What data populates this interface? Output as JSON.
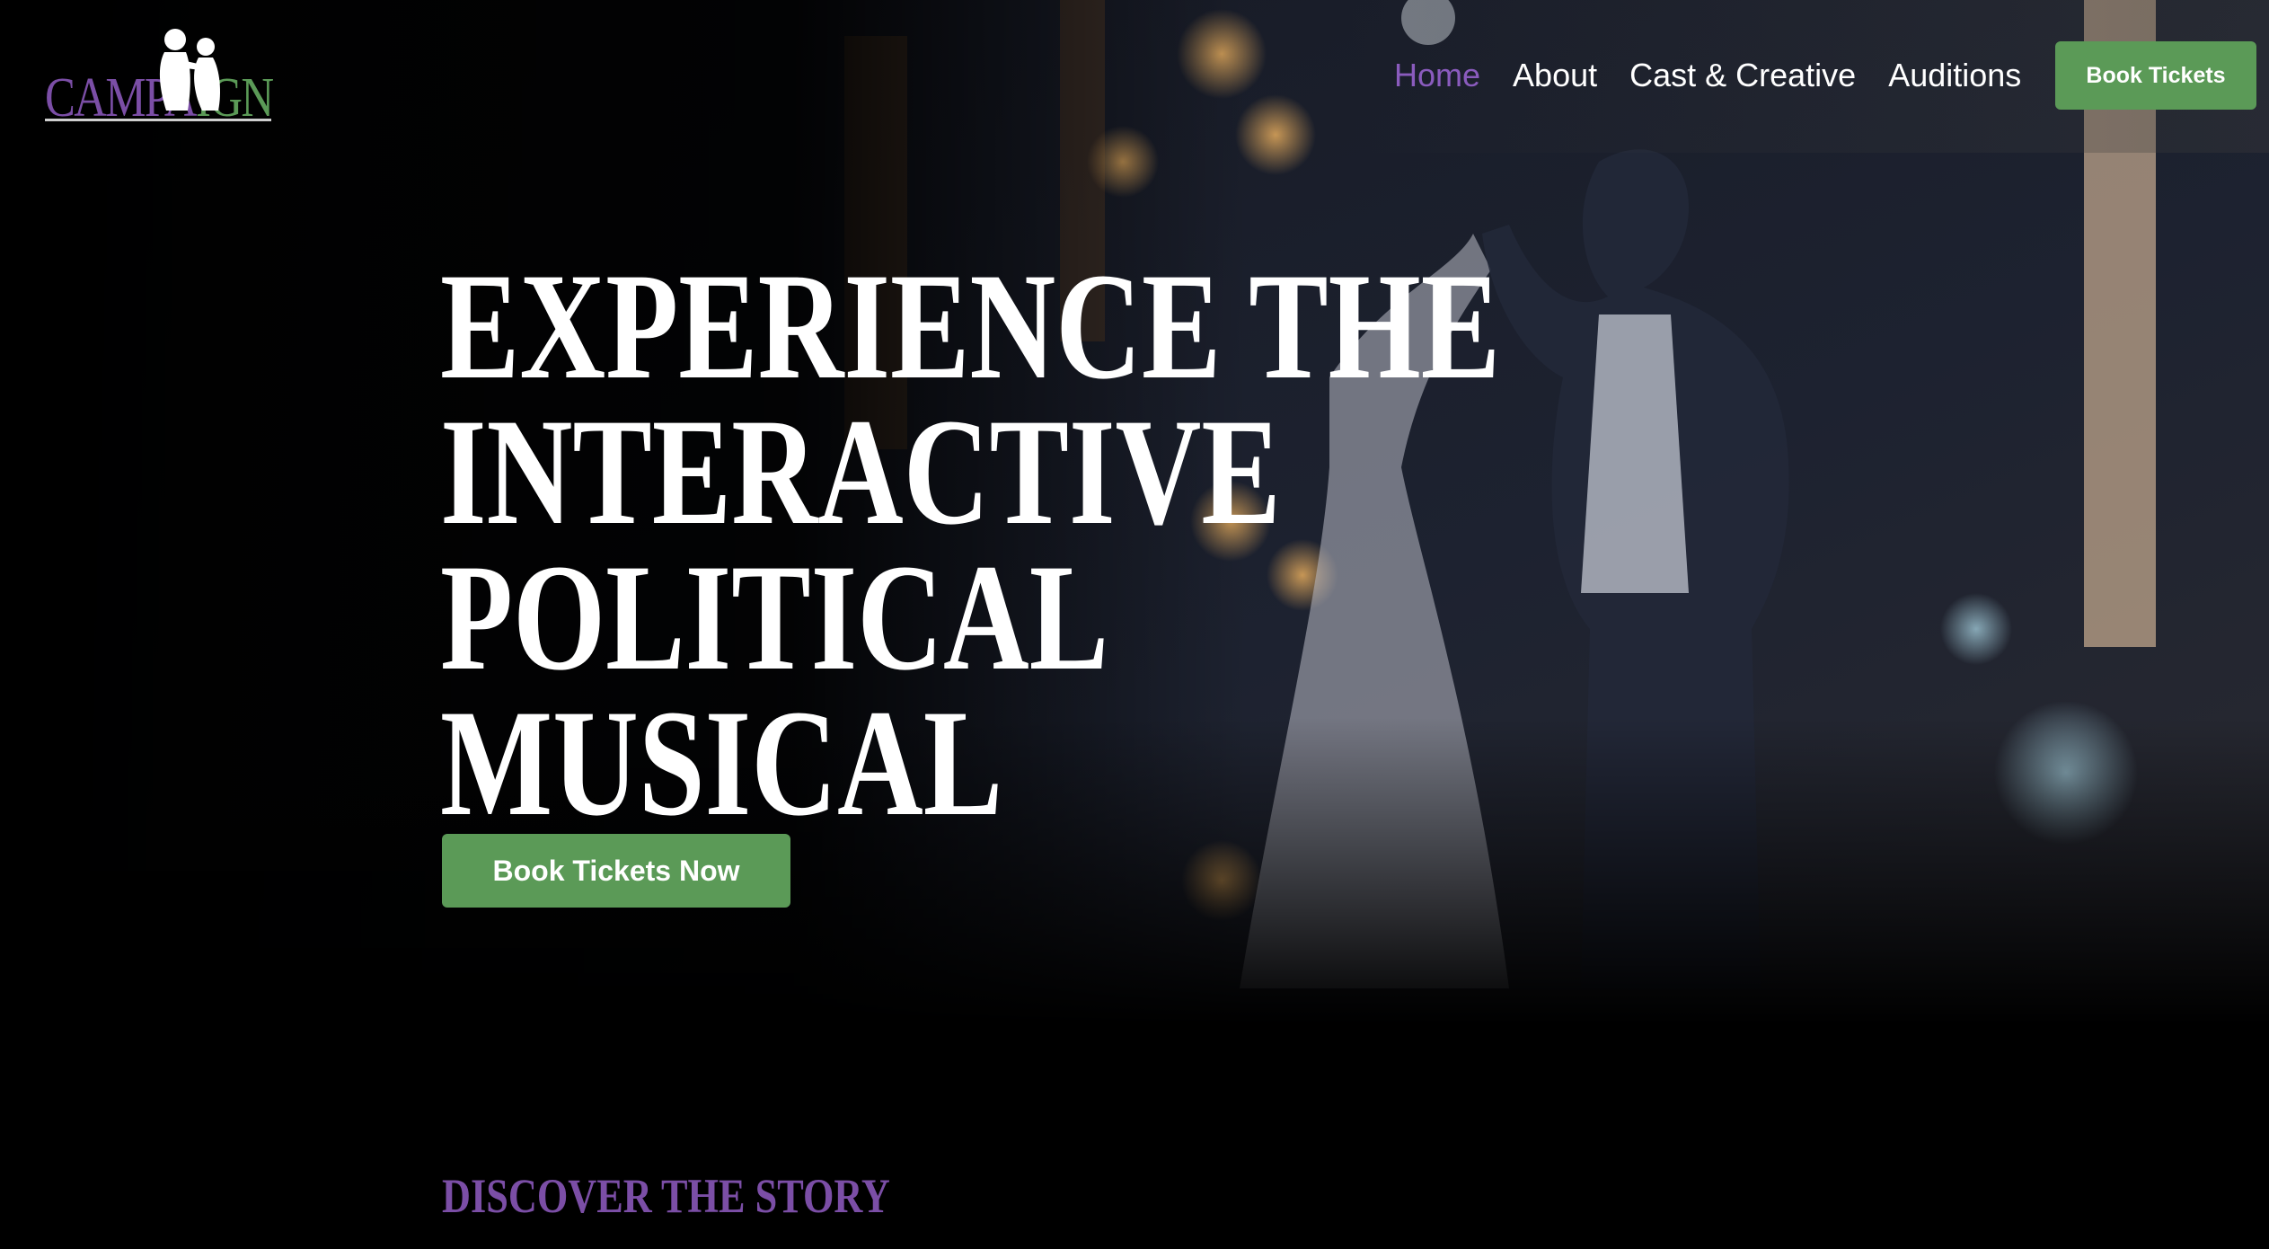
{
  "brand": {
    "logo_left": "CAMPA",
    "logo_right": "IGN",
    "colors": {
      "purple": "#7b4ea6",
      "green": "#5b9a57",
      "nav_active": "#8a5bbd"
    }
  },
  "nav": {
    "items": [
      {
        "label": "Home",
        "active": true
      },
      {
        "label": "About",
        "active": false
      },
      {
        "label": "Cast & Creative",
        "active": false
      },
      {
        "label": "Auditions",
        "active": false
      }
    ],
    "cta_label": "Book Tickets"
  },
  "hero": {
    "headline_lines": [
      "EXPERIENCE THE",
      "INTERACTIVE",
      "POLITICAL",
      "MUSICAL"
    ],
    "cta_label": "Book Tickets Now",
    "image": "stage photo of two performers dancing under candlelight"
  },
  "section": {
    "title": "DISCOVER THE STORY"
  }
}
